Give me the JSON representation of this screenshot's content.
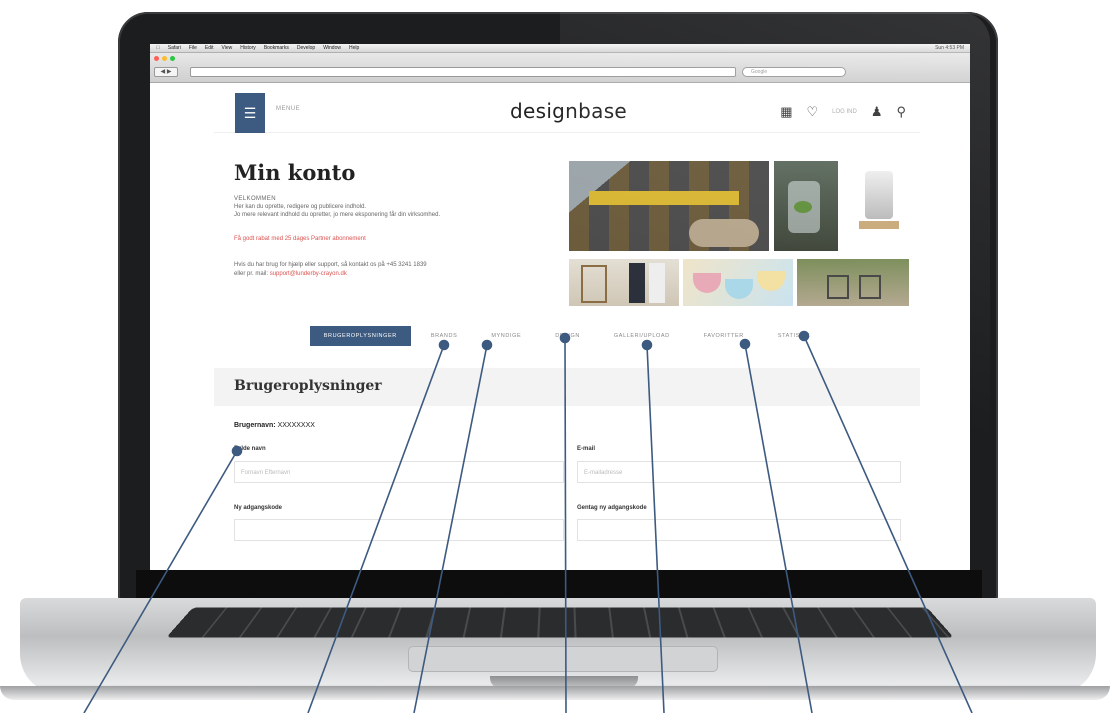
{
  "menubar": {
    "items": [
      "Safari",
      "File",
      "Edit",
      "View",
      "History",
      "Bookmarks",
      "Develop",
      "Window",
      "Help"
    ],
    "status": "Sun 4:53 PM"
  },
  "browser": {
    "nav": "◀ ▶",
    "search_placeholder": "Google"
  },
  "site": {
    "menu_label": "MENUE",
    "logo": "designbase",
    "login_label": "LOG IND"
  },
  "account": {
    "title": "Min konto",
    "welcome_heading": "VELKOMMEN",
    "welcome_lines": [
      "Her kan du oprette, redigere og publicere indhold.",
      "Jo mere relevant indhold du opretter, jo mere eksponering får din virksomhed."
    ],
    "promo": "Få godt rabat med 25 dages Partner abonnement",
    "support_text": "Hvis du har brug for hjælp eller support, så kontakt os på +45 3241 1839",
    "support_email_prefix": "eller pr. mail: ",
    "support_email": "support@lunderby-crayon.dk"
  },
  "tabs": [
    {
      "label": "BRUGEROPLYSNINGER",
      "active": true
    },
    {
      "label": "BRANDS",
      "active": false
    },
    {
      "label": "MYNDIGE",
      "active": false
    },
    {
      "label": "DESIGN",
      "active": false
    },
    {
      "label": "GALLERI/UPLOAD",
      "active": false
    },
    {
      "label": "FAVORITTER",
      "active": false
    },
    {
      "label": "STATISTIK",
      "active": false
    }
  ],
  "profile": {
    "title": "Brugeroplysninger",
    "username_label": "Brugernavn:",
    "username_value": "XXXXXXXX",
    "full_name_label": "Fulde navn",
    "full_name_placeholder": "Fornavn Efternavn",
    "email_label": "E-mail",
    "email_placeholder": "E-mailadresse",
    "new_password_label": "Ny adgangskode",
    "repeat_password_label": "Gentag ny adgangskode"
  },
  "colors": {
    "accent": "#3d5a80",
    "callout": "#3d5a80",
    "promo": "#d9534f"
  }
}
